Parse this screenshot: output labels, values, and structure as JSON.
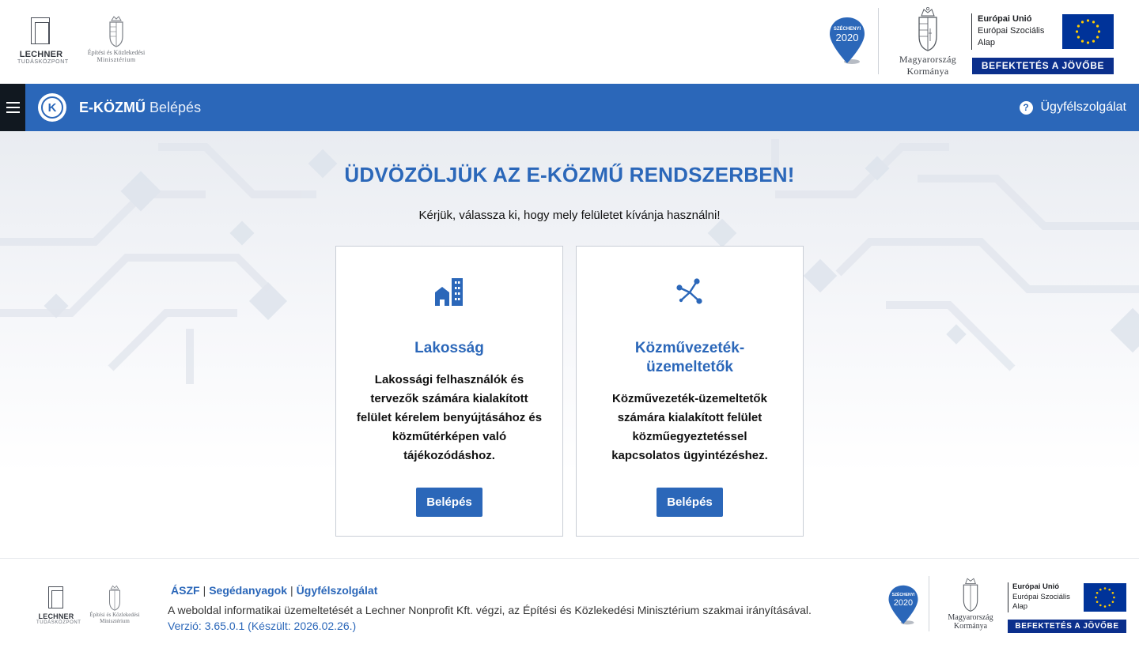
{
  "header": {
    "lechner": {
      "name": "LECHNER",
      "sub": "TUDÁSKÖZPONT"
    },
    "ministry": {
      "line1": "Építési és Közlekedési",
      "line2": "Minisztérium"
    },
    "szechenyi": {
      "top": "SZÉCHENYI",
      "year": "2020"
    },
    "government": {
      "line1": "Magyarország",
      "line2": "Kormánya"
    },
    "eu": {
      "line1": "Európai Unió",
      "line2": "Európai Szociális",
      "line3": "Alap",
      "bar": "BEFEKTETÉS A JÖVŐBE"
    }
  },
  "nav": {
    "logo_letter": "K",
    "brand_bold": "E-KÖZMŰ",
    "brand_light": "Belépés",
    "support_icon": "?",
    "support_label": "Ügyfélszolgálat"
  },
  "main": {
    "title": "ÜDVÖZÖLJÜK AZ E-KÖZMŰ RENDSZERBEN!",
    "subtitle": "Kérjük, válassza ki, hogy mely felületet kívánja használni!",
    "cards": [
      {
        "icon": "buildings-icon",
        "title": "Lakosság",
        "description": "Lakossági felhasználók és tervezők számára kialakított felület kérelem benyújtásához és közműtérképen való tájékozódáshoz.",
        "button": "Belépés"
      },
      {
        "icon": "network-icon",
        "title": "Közművezeték-üzemeltetők",
        "description": "Közművezeték-üzemeltetők számára kialakított felület közműegyeztetéssel kapcsolatos ügyintézéshez.",
        "button": "Belépés"
      }
    ]
  },
  "footer": {
    "links": [
      "ÁSZF",
      "Segédanyagok",
      "Ügyfélszolgálat"
    ],
    "info": "A weboldal informatikai üzemeltetését a Lechner Nonprofit Kft. végzi, az Építési és Közlekedési Minisztérium szakmai irányításával.",
    "version": "Verzió: 3.65.0.1 (Készült: 2026.02.26.)"
  },
  "colors": {
    "primary": "#2b67b9",
    "nav_dark": "#111820",
    "eu_blue": "#003399",
    "eu_bar": "#0b2f8c"
  }
}
